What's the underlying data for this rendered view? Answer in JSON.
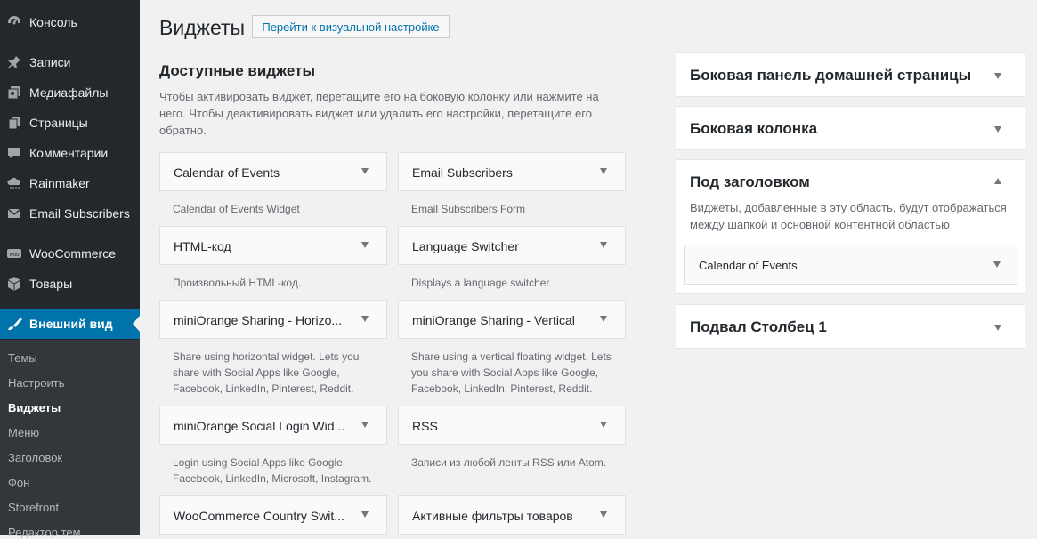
{
  "sidebar": {
    "items": [
      {
        "label": "Консоль",
        "icon": "dashboard-icon"
      },
      {
        "label": "Записи",
        "icon": "pin-icon"
      },
      {
        "label": "Медиафайлы",
        "icon": "media-icon"
      },
      {
        "label": "Страницы",
        "icon": "pages-icon"
      },
      {
        "label": "Комментарии",
        "icon": "comment-icon"
      },
      {
        "label": "Rainmaker",
        "icon": "cloud-icon"
      },
      {
        "label": "Email Subscribers",
        "icon": "envelope-icon"
      },
      {
        "label": "WooCommerce",
        "icon": "woocommerce-icon"
      },
      {
        "label": "Товары",
        "icon": "box-icon"
      },
      {
        "label": "Внешний вид",
        "icon": "brush-icon"
      }
    ],
    "submenu": [
      "Темы",
      "Настроить",
      "Виджеты",
      "Меню",
      "Заголовок",
      "Фон",
      "Storefront",
      "Редактор тем"
    ]
  },
  "header": {
    "title": "Виджеты",
    "customize_button": "Перейти к визуальной настройке"
  },
  "available": {
    "title": "Доступные виджеты",
    "description": "Чтобы активировать виджет, перетащите его на боковую колонку или нажмите на него. Чтобы деактивировать виджет или удалить его настройки, перетащите его обратно.",
    "widgets": [
      {
        "title": "Calendar of Events",
        "desc": "Calendar of Events Widget"
      },
      {
        "title": "Email Subscribers",
        "desc": "Email Subscribers Form"
      },
      {
        "title": "HTML-код",
        "desc": "Произвольный HTML-код."
      },
      {
        "title": "Language Switcher",
        "desc": "Displays a language switcher"
      },
      {
        "title": "miniOrange Sharing - Horizo...",
        "desc": "Share using horizontal widget. Lets you share with Social Apps like Google, Facebook, LinkedIn, Pinterest, Reddit."
      },
      {
        "title": "miniOrange Sharing - Vertical",
        "desc": "Share using a vertical floating widget. Lets you share with Social Apps like Google, Facebook, LinkedIn, Pinterest, Reddit."
      },
      {
        "title": "miniOrange Social Login Wid...",
        "desc": "Login using Social Apps like Google, Facebook, LinkedIn, Microsoft, Instagram."
      },
      {
        "title": "RSS",
        "desc": "Записи из любой ленты RSS или Atom."
      },
      {
        "title": "WooCommerce Country Swit...",
        "desc": ""
      },
      {
        "title": "Активные фильтры товаров",
        "desc": ""
      }
    ]
  },
  "areas": [
    {
      "title": "Боковая панель домашней страницы"
    },
    {
      "title": "Боковая колонка"
    },
    {
      "title": "Под заголовком",
      "description": "Виджеты, добавленные в эту область, будут отображаться между шапкой и основной контентной областью",
      "widget": "Calendar of Events"
    },
    {
      "title": "Подвал Столбец 1"
    }
  ],
  "colors": {
    "sidebar_bg": "#23282d",
    "active": "#0073aa",
    "submenu_bg": "#32373c"
  }
}
